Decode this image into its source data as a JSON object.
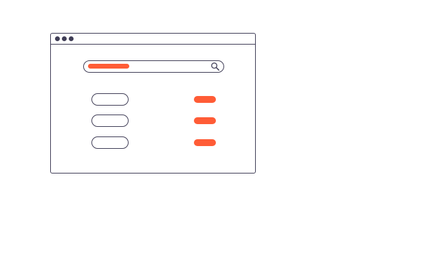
{
  "colors": {
    "accent": "#ff5c36",
    "outline": "#3f3d56",
    "background": "#ffffff"
  },
  "window": {
    "controls": [
      "window-dot",
      "window-dot",
      "window-dot"
    ]
  },
  "search": {
    "icon": "search-icon",
    "query_redacted": true
  },
  "list": {
    "rows": [
      {
        "has_action": true
      },
      {
        "has_action": true
      },
      {
        "has_action": true
      }
    ]
  }
}
